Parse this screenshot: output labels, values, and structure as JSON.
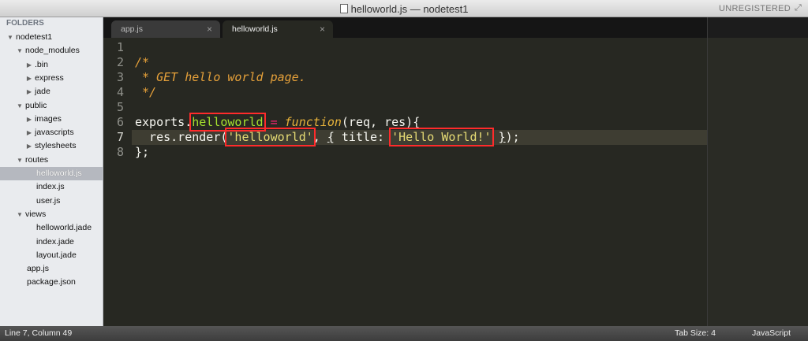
{
  "window": {
    "title": "helloworld.js — nodetest1",
    "registration": "UNREGISTERED"
  },
  "sidebar": {
    "heading": "FOLDERS",
    "items": [
      {
        "label": "nodetest1",
        "type": "folder",
        "expanded": true,
        "level": 0
      },
      {
        "label": "node_modules",
        "type": "folder",
        "expanded": true,
        "level": 1
      },
      {
        "label": ".bin",
        "type": "folder",
        "expanded": false,
        "level": 2
      },
      {
        "label": "express",
        "type": "folder",
        "expanded": false,
        "level": 2
      },
      {
        "label": "jade",
        "type": "folder",
        "expanded": false,
        "level": 2
      },
      {
        "label": "public",
        "type": "folder",
        "expanded": true,
        "level": 1
      },
      {
        "label": "images",
        "type": "folder",
        "expanded": false,
        "level": 2
      },
      {
        "label": "javascripts",
        "type": "folder",
        "expanded": false,
        "level": 2
      },
      {
        "label": "stylesheets",
        "type": "folder",
        "expanded": false,
        "level": 2
      },
      {
        "label": "routes",
        "type": "folder",
        "expanded": true,
        "level": 1
      },
      {
        "label": "helloworld.js",
        "type": "file",
        "selected": true,
        "level": 2
      },
      {
        "label": "index.js",
        "type": "file",
        "level": 2
      },
      {
        "label": "user.js",
        "type": "file",
        "level": 2
      },
      {
        "label": "views",
        "type": "folder",
        "expanded": true,
        "level": 1
      },
      {
        "label": "helloworld.jade",
        "type": "file",
        "level": 2
      },
      {
        "label": "index.jade",
        "type": "file",
        "level": 2
      },
      {
        "label": "layout.jade",
        "type": "file",
        "level": 2
      },
      {
        "label": "app.js",
        "type": "file",
        "level": 1
      },
      {
        "label": "package.json",
        "type": "file",
        "level": 1
      }
    ]
  },
  "tabs": [
    {
      "label": "app.js",
      "active": false,
      "close_icon": "×"
    },
    {
      "label": "helloworld.js",
      "active": true,
      "close_icon": "×"
    }
  ],
  "editor": {
    "line_numbers": [
      "1",
      "2",
      "3",
      "4",
      "5",
      "6",
      "7",
      "8"
    ],
    "current_line": 7,
    "code": {
      "l2": "/*",
      "l3": " * GET hello world page.",
      "l4": " */",
      "l6_exports": "exports.",
      "l6_name": "helloworld",
      "l6_eq": " = ",
      "l6_function": "function",
      "l6_params": "(req, res){",
      "l7_indent_call": "  res.render(",
      "l7_string1": "'helloworld'",
      "l7_comma": ", ",
      "l7_brace_open": "{",
      "l7_key": " title: ",
      "l7_string2": "'Hello World!'",
      "l7_space": " ",
      "l7_brace_close": "}",
      "l7_end": ");",
      "l8": "};"
    }
  },
  "statusbar": {
    "position": "Line 7, Column 49",
    "tab_size": "Tab Size: 4",
    "syntax": "JavaScript"
  },
  "colors": {
    "editor_bg": "#272822",
    "highlight_box": "#ff2b2b",
    "comment": "#e6a13a",
    "string": "#e6db74"
  }
}
